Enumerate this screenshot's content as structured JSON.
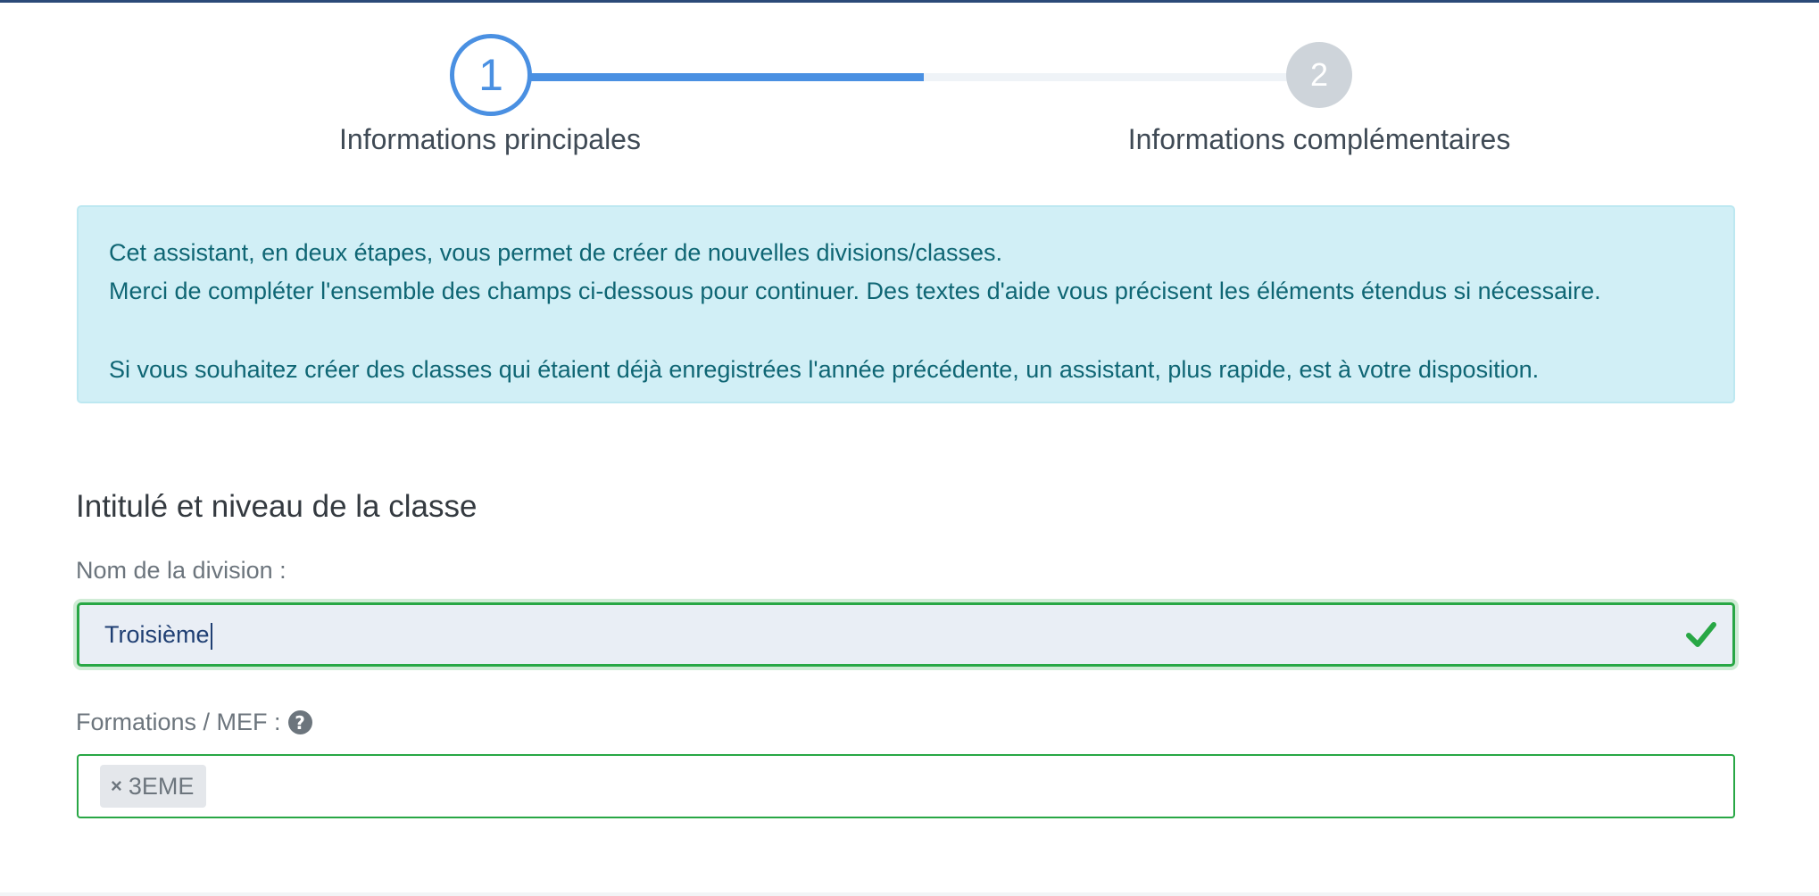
{
  "stepper": {
    "steps": [
      {
        "number": "1",
        "label": "Informations principales",
        "state": "active"
      },
      {
        "number": "2",
        "label": "Informations complémentaires",
        "state": "inactive"
      }
    ],
    "progress": 0.5,
    "active_color": "#4a90e2",
    "inactive_color": "#ced4da"
  },
  "alert": {
    "line1": "Cet assistant, en deux étapes, vous permet de créer de nouvelles divisions/classes.",
    "line2": "Merci de compléter l'ensemble des champs ci-dessous pour continuer. Des textes d'aide vous précisent les éléments étendus si nécessaire.",
    "line3": "Si vous souhaitez créer des classes qui étaient déjà enregistrées l'année précédente, un assistant, plus rapide, est à votre disposition."
  },
  "section": {
    "title": "Intitulé et niveau de la classe"
  },
  "form": {
    "division": {
      "label": "Nom de la division :",
      "value": "Troisième",
      "valid_icon": "check-icon"
    },
    "formations": {
      "label": "Formations / MEF :",
      "help_icon": "question-circle-icon",
      "help_glyph": "?",
      "tags": [
        {
          "remove": "×",
          "label": "3EME"
        }
      ]
    }
  },
  "colors": {
    "valid": "#28a745",
    "alert_bg": "#d1eff6",
    "alert_text": "#0f6674",
    "input_bg": "#e9eef5"
  }
}
